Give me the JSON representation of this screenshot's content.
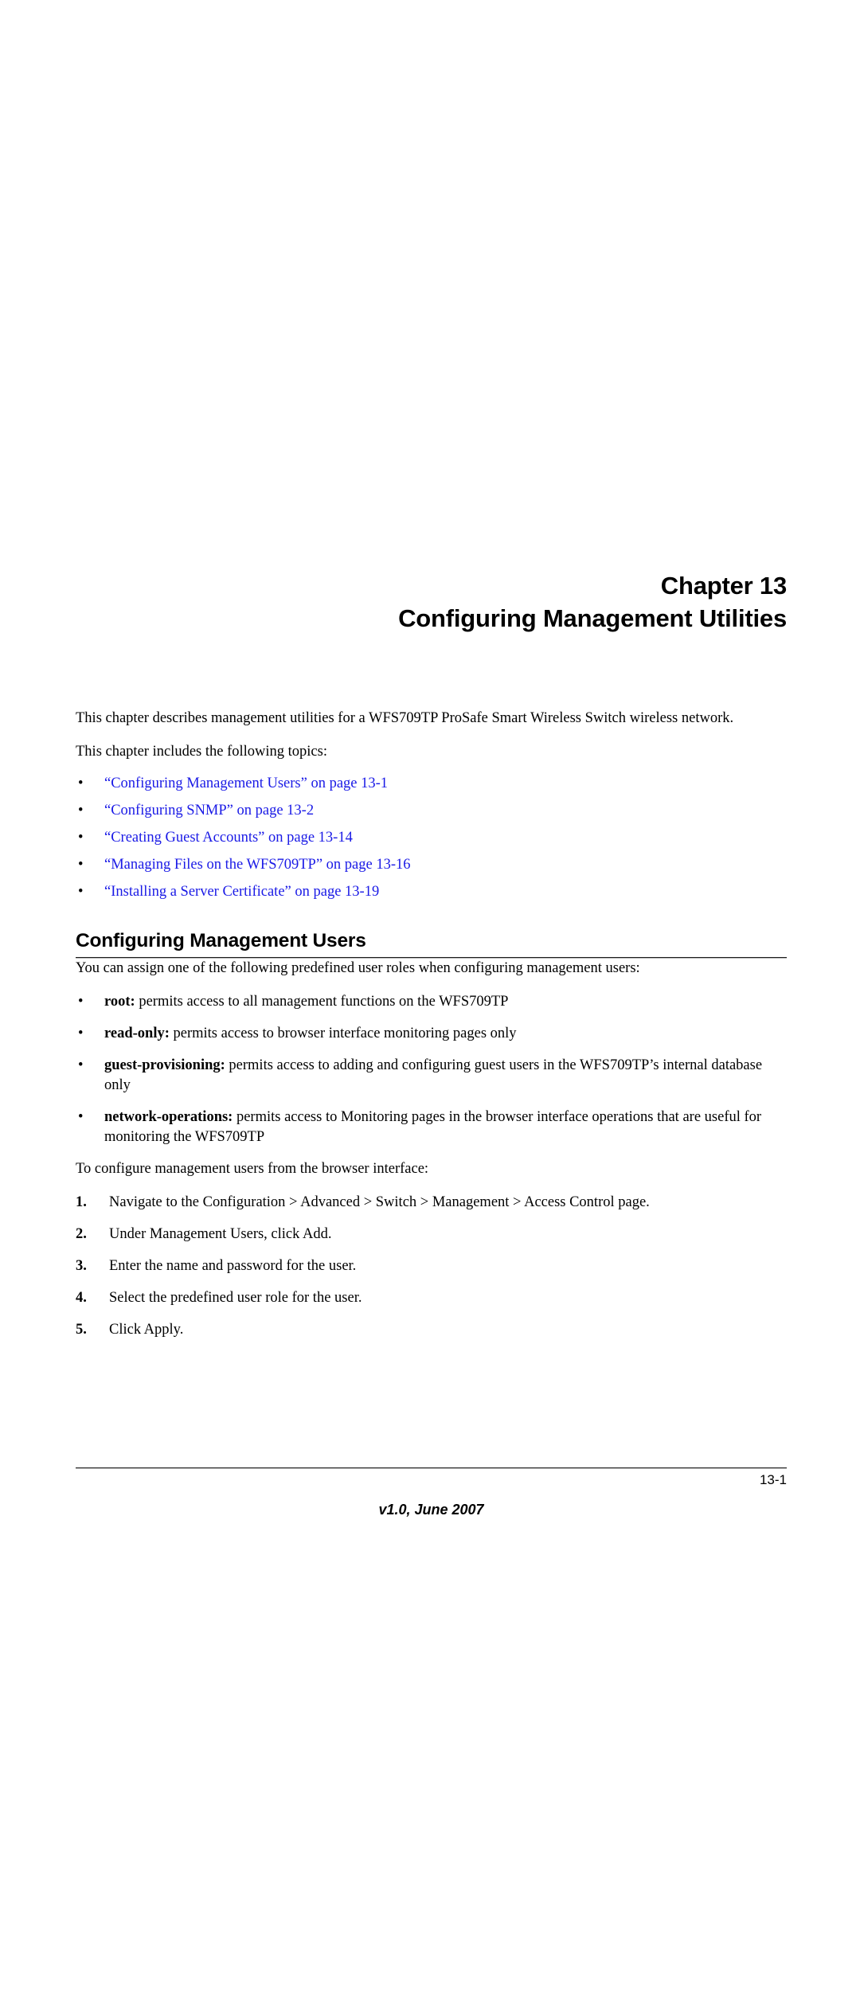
{
  "chapter": {
    "number_label": "Chapter 13",
    "title": "Configuring Management Utilities"
  },
  "intro": {
    "description": "This chapter describes management utilities for a WFS709TP ProSafe Smart Wireless Switch wireless network.",
    "topics_lead": "This chapter includes the following topics:",
    "bullet_glyph": "•"
  },
  "toc": {
    "items": [
      {
        "text": "“Configuring Management Users” on page 13-1"
      },
      {
        "text": "“Configuring SNMP” on page 13-2"
      },
      {
        "text": "“Creating Guest Accounts” on page 13-14"
      },
      {
        "text": "“Managing Files on the WFS709TP” on page 13-16"
      },
      {
        "text": "“Installing a Server Certificate” on page 13-19"
      }
    ]
  },
  "section": {
    "heading": "Configuring Management Users",
    "lead_paragraph": "You can assign one of the following predefined user roles when configuring management users:",
    "roles": [
      {
        "term": "root:",
        "description": " permits access to all management functions on the WFS709TP"
      },
      {
        "term": "read-only:",
        "description": " permits access to browser interface monitoring pages only"
      },
      {
        "term": "guest-provisioning:",
        "description": " permits access to adding and configuring guest users in the WFS709TP’s internal database only"
      },
      {
        "term": "network-operations:",
        "description": " permits access to Monitoring pages in the browser interface operations that are useful for monitoring the WFS709TP"
      }
    ],
    "steps_lead": "To configure management users from the browser interface:",
    "steps": [
      {
        "number": "1.",
        "text": "Navigate to the Configuration > Advanced > Switch > Management > Access Control page."
      },
      {
        "number": "2.",
        "text": "Under Management Users, click Add."
      },
      {
        "number": "3.",
        "text": "Enter the name and password for the user."
      },
      {
        "number": "4.",
        "text": "Select the predefined user role for the user."
      },
      {
        "number": "5.",
        "text": "Click Apply."
      }
    ]
  },
  "footer": {
    "page_number": "13-1",
    "version": "v1.0, June 2007"
  },
  "colors": {
    "link": "#1a1ae6",
    "text": "#000000",
    "rule": "#1c1c1c",
    "page_background": "#ffffff"
  }
}
